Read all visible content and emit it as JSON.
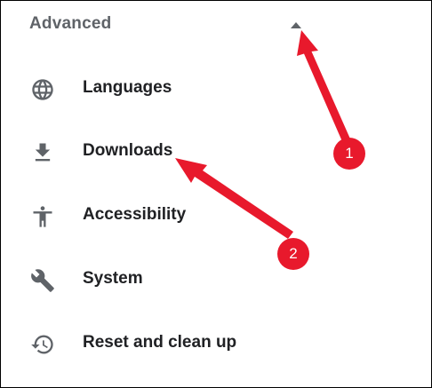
{
  "section": {
    "title": "Advanced"
  },
  "menu": {
    "items": [
      {
        "label": "Languages",
        "icon": "globe-icon"
      },
      {
        "label": "Downloads",
        "icon": "download-icon"
      },
      {
        "label": "Accessibility",
        "icon": "accessibility-icon"
      },
      {
        "label": "System",
        "icon": "wrench-icon"
      },
      {
        "label": "Reset and clean up",
        "icon": "restore-icon"
      }
    ]
  },
  "annotations": {
    "badge_1": "1",
    "badge_2": "2",
    "color": "#e8192c"
  },
  "colors": {
    "header_text": "#5f6368",
    "item_text": "#202124",
    "icon": "#5f6368",
    "annotation": "#e8192c"
  }
}
